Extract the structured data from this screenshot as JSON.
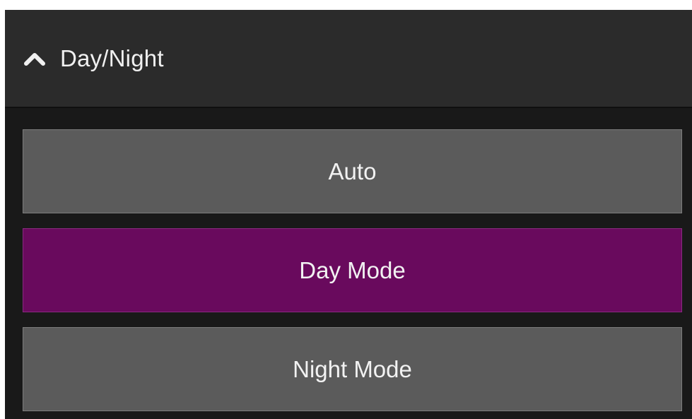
{
  "section": {
    "title": "Day/Night",
    "expanded_icon": "chevron-up-icon"
  },
  "options": [
    {
      "label": "Auto",
      "selected": false
    },
    {
      "label": "Day Mode",
      "selected": true
    },
    {
      "label": "Night Mode",
      "selected": false
    }
  ],
  "colors": {
    "panel_background": "#191919",
    "header_background": "#2b2b2b",
    "option_background": "#5b5b5b",
    "option_selected_background": "#690a5d",
    "text": "#f2f2f2"
  }
}
